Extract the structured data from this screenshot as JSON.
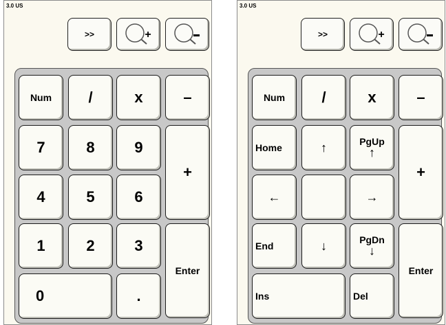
{
  "version_label": "3.0 US",
  "toolbar": {
    "forward_label": ">>",
    "zoom_in_icon": "zoom-in-icon",
    "zoom_out_icon": "zoom-out-icon"
  },
  "left_pad": {
    "num": "Num",
    "divide": "/",
    "multiply": "x",
    "minus": "–",
    "k7": "7",
    "k8": "8",
    "k9": "9",
    "plus": "+",
    "k4": "4",
    "k5": "5",
    "k6": "6",
    "k1": "1",
    "k2": "2",
    "k3": "3",
    "enter": "Enter",
    "k0": "0",
    "dot": "."
  },
  "right_pad": {
    "num": "Num",
    "divide": "/",
    "multiply": "x",
    "minus": "–",
    "home": "Home",
    "up_arrow": "↑",
    "pgup": "PgUp",
    "pgup_arrow": "↑",
    "plus": "+",
    "left_arrow": "←",
    "center": "",
    "right_arrow": "→",
    "end": "End",
    "down_arrow": "↓",
    "pgdn": "PgDn",
    "pgdn_arrow": "↓",
    "enter": "Enter",
    "ins": "Ins",
    "del": "Del"
  }
}
